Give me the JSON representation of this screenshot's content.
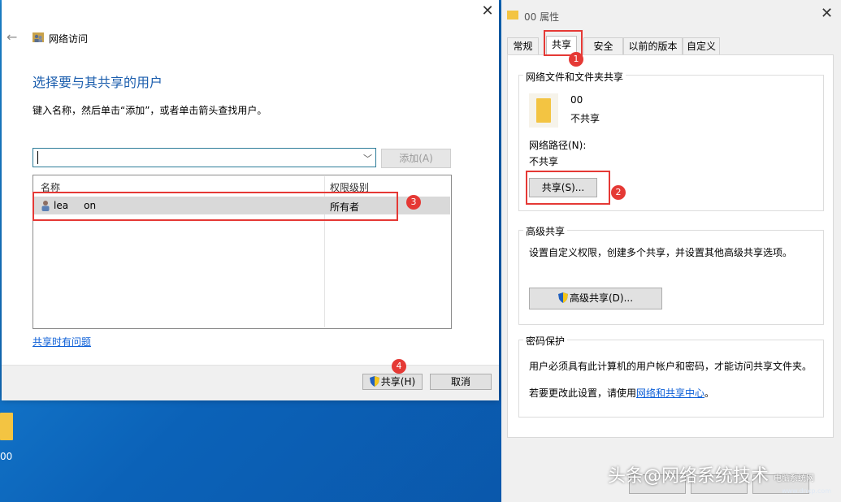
{
  "desktop": {
    "folder_label": "00"
  },
  "network_access": {
    "title": "网络访问",
    "heading": "选择要与其共享的用户",
    "instructions": "键入名称，然后单击“添加”，或者单击箭头查找用户。",
    "input_value": "",
    "add_label": "添加(A)",
    "columns": {
      "name": "名称",
      "permission": "权限级别"
    },
    "users": [
      {
        "name": "lea     on",
        "permission": "所有者"
      }
    ],
    "help_link": "共享时有问题",
    "share_label": "共享(H)",
    "cancel_label": "取消"
  },
  "properties": {
    "title": "00 属性",
    "tabs": [
      "常规",
      "共享",
      "安全",
      "以前的版本",
      "自定义"
    ],
    "active_tab": "共享",
    "network_share": {
      "title": "网络文件和文件夹共享",
      "folder_name": "00",
      "status": "不共享",
      "path_label": "网络路径(N):",
      "path_value": "不共享",
      "share_button": "共享(S)..."
    },
    "advanced": {
      "title": "高级共享",
      "description": "设置自定义权限，创建多个共享，并设置其他高级共享选项。",
      "button": "高级共享(D)..."
    },
    "password": {
      "title": "密码保护",
      "description": "用户必须具有此计算机的用户帐户和密码，才能访问共享文件夹。",
      "change_prefix": "若要更改此设置，请使用",
      "change_link": "网络和共享中心",
      "change_suffix": "。"
    }
  },
  "annotations": [
    "1",
    "2",
    "3",
    "4"
  ],
  "watermark": {
    "text": "头条@网络系统技术",
    "site": "电脑系统网",
    "url": "www.dnxp.com"
  },
  "colors": {
    "highlight": "#e53935",
    "heading_blue": "#1d5fae",
    "link_blue": "#0b5ed7"
  }
}
